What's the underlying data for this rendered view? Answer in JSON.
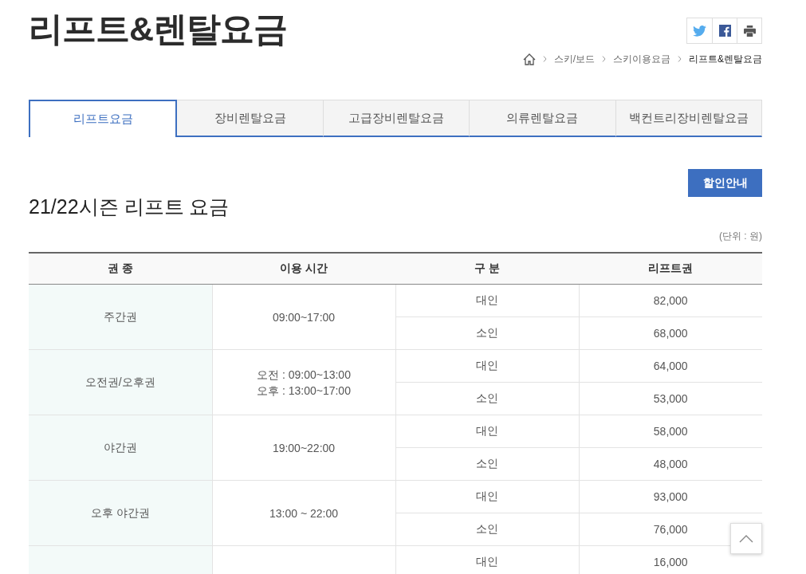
{
  "page_title": "리프트&렌탈요금",
  "breadcrumb": [
    {
      "label": "스키/보드",
      "current": false
    },
    {
      "label": "스키이용요금",
      "current": false
    },
    {
      "label": "리프트&렌탈요금",
      "current": true
    }
  ],
  "tabs": [
    {
      "label": "리프트요금",
      "selected": true
    },
    {
      "label": "장비렌탈요금",
      "selected": false
    },
    {
      "label": "고급장비렌탈요금",
      "selected": false
    },
    {
      "label": "의류렌탈요금",
      "selected": false
    },
    {
      "label": "백컨트리장비렌탈요금",
      "selected": false
    }
  ],
  "discount_button": "할인안내",
  "section_title": "21/22시즌 리프트 요금",
  "unit_note": "(단위 : 원)",
  "table": {
    "columns": [
      "권 종",
      "이용 시간",
      "구 분",
      "리프트권"
    ],
    "groups": [
      {
        "pass": "주간권",
        "hours": [
          "09:00~17:00"
        ],
        "rows": [
          {
            "category": "대인",
            "price": "82,000"
          },
          {
            "category": "소인",
            "price": "68,000"
          }
        ]
      },
      {
        "pass": "오전권/오후권",
        "hours": [
          "오전 : 09:00~13:00",
          "오후 : 13:00~17:00"
        ],
        "rows": [
          {
            "category": "대인",
            "price": "64,000"
          },
          {
            "category": "소인",
            "price": "53,000"
          }
        ]
      },
      {
        "pass": "야간권",
        "hours": [
          "19:00~22:00"
        ],
        "rows": [
          {
            "category": "대인",
            "price": "58,000"
          },
          {
            "category": "소인",
            "price": "48,000"
          }
        ]
      },
      {
        "pass": "오후 야간권",
        "hours": [
          "13:00 ~ 22:00"
        ],
        "rows": [
          {
            "category": "대인",
            "price": "93,000"
          },
          {
            "category": "소인",
            "price": "76,000"
          }
        ]
      },
      {
        "rows": [
          {
            "category": "대인",
            "price": "16,000"
          }
        ]
      }
    ]
  }
}
